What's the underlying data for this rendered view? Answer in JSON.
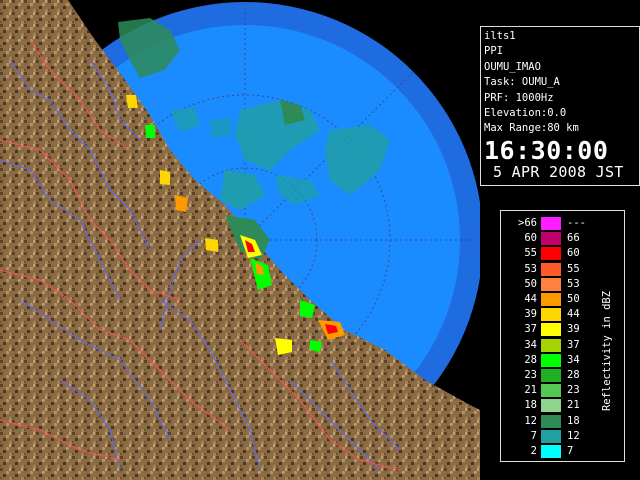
{
  "info": {
    "product": "ilts1",
    "scan_mode": "PPI",
    "radar": "OUMU_IMAO",
    "task": "Task: OUMU_A",
    "prf": "PRF: 1000Hz",
    "elevation": "Elevation:0.0",
    "max_range": "Max Range:80 km",
    "time": "16:30:00",
    "date": "5 APR 2008 JST"
  },
  "legend": {
    "unit_label": "Reflectivity in dBZ",
    "rows": [
      {
        "lo": ">66",
        "hi": "---",
        "color": "#ff1dff"
      },
      {
        "lo": "60",
        "hi": "66",
        "color": "#c0006a"
      },
      {
        "lo": "55",
        "hi": "60",
        "color": "#ff0000"
      },
      {
        "lo": "53",
        "hi": "55",
        "color": "#ff5a2a"
      },
      {
        "lo": "50",
        "hi": "53",
        "color": "#ff8040"
      },
      {
        "lo": "44",
        "hi": "50",
        "color": "#ff9900"
      },
      {
        "lo": "39",
        "hi": "44",
        "color": "#ffd700"
      },
      {
        "lo": "37",
        "hi": "39",
        "color": "#ffff00"
      },
      {
        "lo": "34",
        "hi": "37",
        "color": "#a5d400"
      },
      {
        "lo": "28",
        "hi": "34",
        "color": "#00ff00"
      },
      {
        "lo": "23",
        "hi": "28",
        "color": "#22b022"
      },
      {
        "lo": "21",
        "hi": "23",
        "color": "#53c853"
      },
      {
        "lo": "18",
        "hi": "21",
        "color": "#8fd48f"
      },
      {
        "lo": "12",
        "hi": "18",
        "color": "#2e8b57"
      },
      {
        "lo": "7",
        "hi": "12",
        "color": "#20a0a0"
      },
      {
        "lo": "2",
        "hi": "7",
        "color": "#00ffff"
      }
    ]
  },
  "map_colors": {
    "background": "#000000",
    "outer_ring": "#1e6cdf",
    "inner_disc": "#1b8cff",
    "land": "#8a6b44",
    "rivers": "#5b6aff",
    "borders": "#ff5050"
  }
}
